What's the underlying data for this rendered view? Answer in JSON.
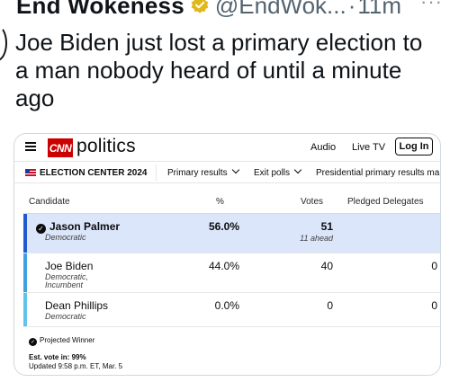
{
  "tweet": {
    "author": "End Wokeness",
    "handle": "@EndWok...",
    "separator": "·",
    "time": "11m",
    "more": "···",
    "text": "Joe Biden just lost a primary election to a man nobody heard of until a minute ago"
  },
  "cnn": {
    "logo": "CNN",
    "section": "politics",
    "nav": {
      "audio": "Audio",
      "live_tv": "Live TV",
      "login": "Log In"
    },
    "election_center": "ELECTION CENTER 2024",
    "subnav": [
      "Primary results",
      "Exit polls",
      "Presidential primary results ma"
    ]
  },
  "table": {
    "headers": {
      "candidate": "Candidate",
      "percent": "%",
      "votes": "Votes",
      "delegates": "Pledged Delegates"
    },
    "rows": [
      {
        "name": "Jason Palmer",
        "party": [
          "Democratic"
        ],
        "percent": "56.0%",
        "votes": "51",
        "note": "11 ahead",
        "delegates": "",
        "winner": true,
        "color": "#1f5ad3"
      },
      {
        "name": "Joe Biden",
        "party": [
          "Democratic,",
          "Incumbent"
        ],
        "percent": "44.0%",
        "votes": "40",
        "note": "",
        "delegates": "0",
        "winner": false,
        "color": "#3ea1e0"
      },
      {
        "name": "Dean Phillips",
        "party": [
          "Democratic"
        ],
        "percent": "0.0%",
        "votes": "0",
        "note": "",
        "delegates": "0",
        "winner": false,
        "color": "#5fc3ec"
      }
    ]
  },
  "footer": {
    "projected": "Projected Winner",
    "est_vote": "Est. vote in: 99%",
    "updated": "Updated 9:58 p.m. ET, Mar. 5"
  },
  "colors": {
    "cnn_red": "#cc0000",
    "winner_bg": "#dbe6fb",
    "verified_gold": "#e2b719"
  }
}
